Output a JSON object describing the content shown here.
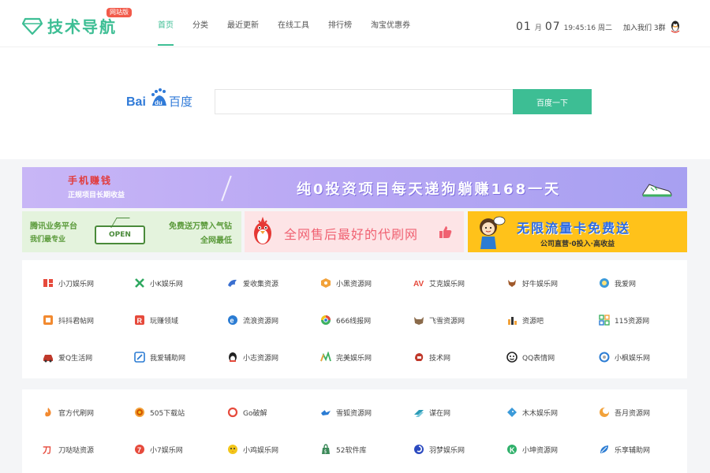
{
  "header": {
    "logo_text": "技术导航",
    "logo_badge": "网站版",
    "nav": [
      "首页",
      "分类",
      "最近更新",
      "在线工具",
      "排行榜",
      "淘宝优惠券"
    ],
    "active_nav_index": 0,
    "clock": {
      "month": "01",
      "month_unit": "月",
      "day": "07",
      "time": "19:45:16 周二"
    },
    "join_label": "加入我们 3群"
  },
  "search": {
    "engine_logo": "Bai百度",
    "placeholder": "",
    "value": "",
    "button_label": "百度一下"
  },
  "banners": {
    "top": {
      "left_title": "手机赚钱",
      "left_sub": "正规项目长期收益",
      "headline": "纯0投资项目每天递狗躺赚168一天"
    },
    "ad1": {
      "left_top": "腾讯业务平台",
      "left_bottom": "我们最专业",
      "sign": "OPEN",
      "right_top": "免费送万赞入气钻",
      "right_bottom": "全网最低"
    },
    "ad2": {
      "text": "全网售后最好的代刷网"
    },
    "ad3": {
      "title": "无限流量卡免费送",
      "sub": "公司直营·0投入·高收益"
    }
  },
  "sites_panel1": [
    {
      "label": "小刀娱乐网",
      "icon": "xiaodao-icon",
      "color": "#e64a3c"
    },
    {
      "label": "小K娱乐网",
      "icon": "k-icon",
      "color": "#2fa860"
    },
    {
      "label": "爱收集资源",
      "icon": "dolphin-icon",
      "color": "#3a6fd0"
    },
    {
      "label": "小黑资源网",
      "icon": "hexagon-icon",
      "color": "#f2a23a"
    },
    {
      "label": "艾克娱乐网",
      "icon": "av-icon",
      "color": "#e64a3c"
    },
    {
      "label": "好牛娱乐网",
      "icon": "bull-icon",
      "color": "#a05a2c"
    },
    {
      "label": "我爱网",
      "icon": "globe-icon",
      "color": "#3b9ad9"
    },
    {
      "label": "抖抖君帖网",
      "icon": "box-icon",
      "color": "#f28a30"
    },
    {
      "label": "玩赚领域",
      "icon": "r-icon",
      "color": "#e64a3c"
    },
    {
      "label": "流浪资源网",
      "icon": "e-icon",
      "color": "#2b7cd3"
    },
    {
      "label": "666线报网",
      "icon": "chrome-icon",
      "color": "#e64a3c"
    },
    {
      "label": "飞雪资源网",
      "icon": "wolf-icon",
      "color": "#8a6a4a"
    },
    {
      "label": "资源吧",
      "icon": "bars-icon",
      "color": "#f2a23a"
    },
    {
      "label": "115资源网",
      "icon": "grid-icon",
      "color": "#3db060"
    },
    {
      "label": "爱Q生活网",
      "icon": "car-icon",
      "color": "#c0392b"
    },
    {
      "label": "我爱辅助网",
      "icon": "slash-icon",
      "color": "#2b7cd3"
    },
    {
      "label": "小志资源网",
      "icon": "penguin-icon",
      "color": "#e64a3c"
    },
    {
      "label": "完美娱乐网",
      "icon": "chart-icon",
      "color": "#3db060"
    },
    {
      "label": "技术网",
      "icon": "helmet-icon",
      "color": "#c0392b"
    },
    {
      "label": "QQ表情网",
      "icon": "smile-icon",
      "color": "#222222"
    },
    {
      "label": "小枫娱乐网",
      "icon": "circle-icon",
      "color": "#2b7cd3"
    }
  ],
  "sites_panel2": [
    {
      "label": "官方代刷网",
      "icon": "flame-icon",
      "color": "#f28a30"
    },
    {
      "label": "505下载站",
      "icon": "coin-icon",
      "color": "#d35400"
    },
    {
      "label": "Go破解",
      "icon": "ring-icon",
      "color": "#e64a3c"
    },
    {
      "label": "雪狐资源网",
      "icon": "fox-icon",
      "color": "#2b7cd3"
    },
    {
      "label": "谋在网",
      "icon": "stack-icon",
      "color": "#2b9bb6"
    },
    {
      "label": "木木娱乐网",
      "icon": "bird-icon",
      "color": "#3b9ad9"
    },
    {
      "label": "吾月资源网",
      "icon": "moon-icon",
      "color": "#f2a23a"
    },
    {
      "label": "刀哒哒资源",
      "icon": "zh-icon",
      "color": "#e64a3c"
    },
    {
      "label": "小7娱乐网",
      "icon": "seven-icon",
      "color": "#e64a3c"
    },
    {
      "label": "小鸡娱乐网",
      "icon": "chick-icon",
      "color": "#f2c61a"
    },
    {
      "label": "52软件库",
      "icon": "bag-icon",
      "color": "#3d8a5a"
    },
    {
      "label": "羽梦娱乐网",
      "icon": "swirl-icon",
      "color": "#2b4ac0"
    },
    {
      "label": "小坤资源网",
      "icon": "k2-icon",
      "color": "#2fb06a"
    },
    {
      "label": "乐享辅助网",
      "icon": "leaf-icon",
      "color": "#2b7cd3"
    }
  ]
}
